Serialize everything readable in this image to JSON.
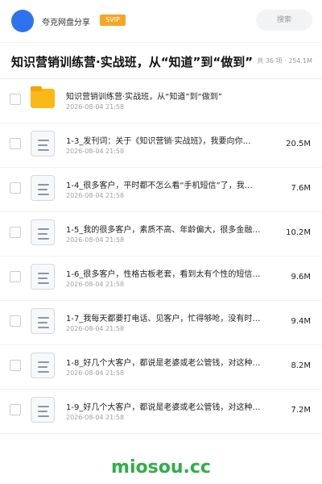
{
  "header": {
    "app_name": "夸克网盘分享",
    "badge": "SVIP",
    "search_label": "搜索"
  },
  "folder_title": "知识营销训练营·实战班，从“知道”到“做到”",
  "summary": "共 36 项 · 254.1M",
  "items": [
    {
      "type": "folder",
      "name": "知识营销训练营·实战班，从“知道”到“做到”",
      "date": "2026-08-04 21:58",
      "size": ""
    },
    {
      "type": "file",
      "name": "1-3_发刊词：关于《知识营销·实战班》，我要向你…",
      "date": "2026-08-04 21:58",
      "size": "20.5M"
    },
    {
      "type": "file",
      "name": "1-4_很多客户，平时都不怎么看“手机短信”了，我…",
      "date": "2026-08-04 21:58",
      "size": "7.6M"
    },
    {
      "type": "file",
      "name": "1-5_我的很多客户，素质不高、年龄偏大，很多金融…",
      "date": "2026-08-04 21:58",
      "size": "10.2M"
    },
    {
      "type": "file",
      "name": "1-6_很多客户，性格古板老套，看到太有个性的短信…",
      "date": "2026-08-04 21:58",
      "size": "9.6M"
    },
    {
      "type": "file",
      "name": "1-7_我每天都要打电话、见客户，忙得够呛，没有时…",
      "date": "2026-08-04 21:58",
      "size": "9.4M"
    },
    {
      "type": "file",
      "name": "1-8_好几个大客户，都说是老婆或老公管钱，对这种…",
      "date": "2026-08-04 21:58",
      "size": "8.2M"
    },
    {
      "type": "file",
      "name": "1-9_好几个大客户，都说是老婆或老公管钱，对这种…",
      "date": "2026-08-04 21:58",
      "size": "7.2M"
    }
  ],
  "footer": {
    "watermark": "miosou.cc"
  },
  "colors": {
    "accent": "#2d73f0",
    "badge": "#f5a623",
    "folder": "#fbb917",
    "watermark": "#2fae49"
  }
}
